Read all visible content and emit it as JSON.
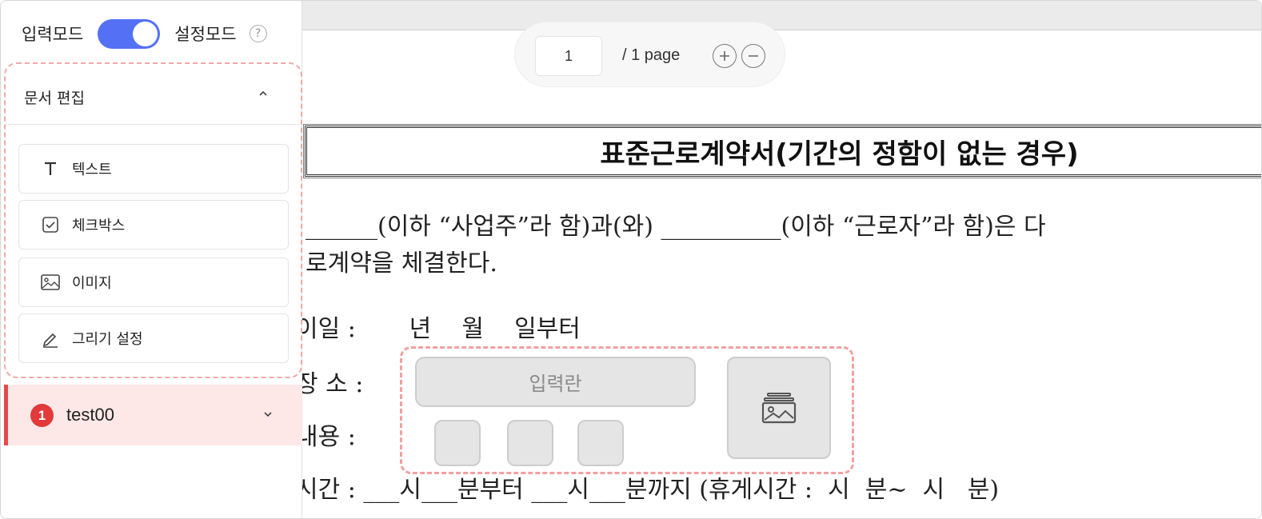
{
  "mode": {
    "input_label": "입력모드",
    "setting_label": "설정모드",
    "toggle_on": true
  },
  "edit_panel": {
    "title": "문서 편집",
    "tools": [
      {
        "label": "텍스트",
        "icon": "text-icon"
      },
      {
        "label": "체크박스",
        "icon": "checkbox-icon"
      },
      {
        "label": "이미지",
        "icon": "image-icon"
      },
      {
        "label": "그리기 설정",
        "icon": "pen-icon"
      }
    ]
  },
  "recipient": {
    "number": "1",
    "name": "test00"
  },
  "page_nav": {
    "current": "1",
    "total_label": "/ 1 page"
  },
  "document": {
    "title": "표준근로계약서(기간의 정함이 없는 경우)",
    "line1": "______(이하 “사업주”라 함)과(와) __________(이하 “근로자”라 함)은 다",
    "line2": "로계약을 체결한다.",
    "line3": "이일 :       년    월    일부터",
    "line4": "장 소 :",
    "line5": "내용 :",
    "line6": "시간 : ___시___분부터 ___시___분까지 (휴게시간 :  시  분~  시   분)"
  },
  "field_overlay": {
    "input_placeholder": "입력란"
  },
  "colors": {
    "accent": "#5470f5",
    "dashed_outline": "#f2a0a0",
    "recipient_bg": "#fde7e7",
    "badge": "#e23a3a"
  }
}
